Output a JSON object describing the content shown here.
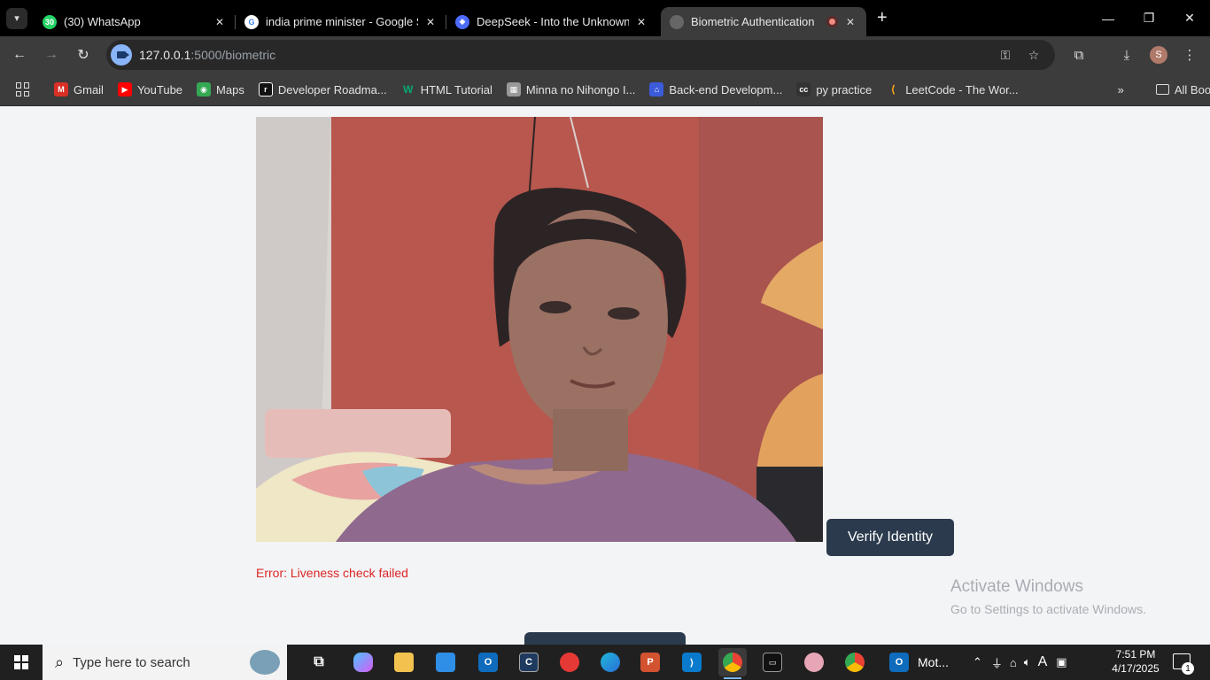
{
  "browser": {
    "tabs": [
      {
        "title": "(30) WhatsApp",
        "favicon": "whatsapp-icon",
        "badge": "30",
        "color": "#25d366"
      },
      {
        "title": "india prime minister - Google S",
        "favicon": "google-icon",
        "color": "#4285f4"
      },
      {
        "title": "DeepSeek - Into the Unknown",
        "favicon": "deepseek-icon",
        "color": "#4d6bfe"
      },
      {
        "title": "Biometric Authentication",
        "favicon": "globe-icon",
        "color": "#777777"
      }
    ],
    "address": {
      "host": "127.0.0.1",
      "path": ":5000/biometric"
    },
    "profile_initial": "S",
    "bookmarks": [
      {
        "label": "Gmail",
        "icon": "gmail-icon",
        "color": "#d93025"
      },
      {
        "label": "YouTube",
        "icon": "youtube-icon",
        "color": "#ff0000"
      },
      {
        "label": "Maps",
        "icon": "maps-icon",
        "color": "#34a853"
      },
      {
        "label": "Developer Roadma...",
        "icon": "roadmap-icon",
        "color": "#111111"
      },
      {
        "label": "HTML Tutorial",
        "icon": "w3schools-icon",
        "color": "#04aa6d"
      },
      {
        "label": "Minna no Nihongo I...",
        "icon": "book-icon",
        "color": "#888888"
      },
      {
        "label": "Back-end Developm...",
        "icon": "course-icon",
        "color": "#3b5bdb"
      },
      {
        "label": "py practice",
        "icon": "cc-icon",
        "color": "#333333"
      },
      {
        "label": "LeetCode - The Wor...",
        "icon": "leetcode-icon",
        "color": "#ffa116"
      }
    ],
    "all_bookmarks": "All Bookmarks"
  },
  "page": {
    "verify_button": "Verify Identity",
    "error_message": "Error: Liveness check failed",
    "watermark": {
      "title": "Activate Windows",
      "subtitle": "Go to Settings to activate Windows."
    },
    "colors": {
      "button": "#2b3a4d",
      "error": "#dc2626",
      "background": "#f3f4f6"
    }
  },
  "taskbar": {
    "search_placeholder": "Type here to search",
    "outlook_label": "Mot...",
    "time": "7:51 PM",
    "date": "4/17/2025",
    "notification_count": "1"
  }
}
